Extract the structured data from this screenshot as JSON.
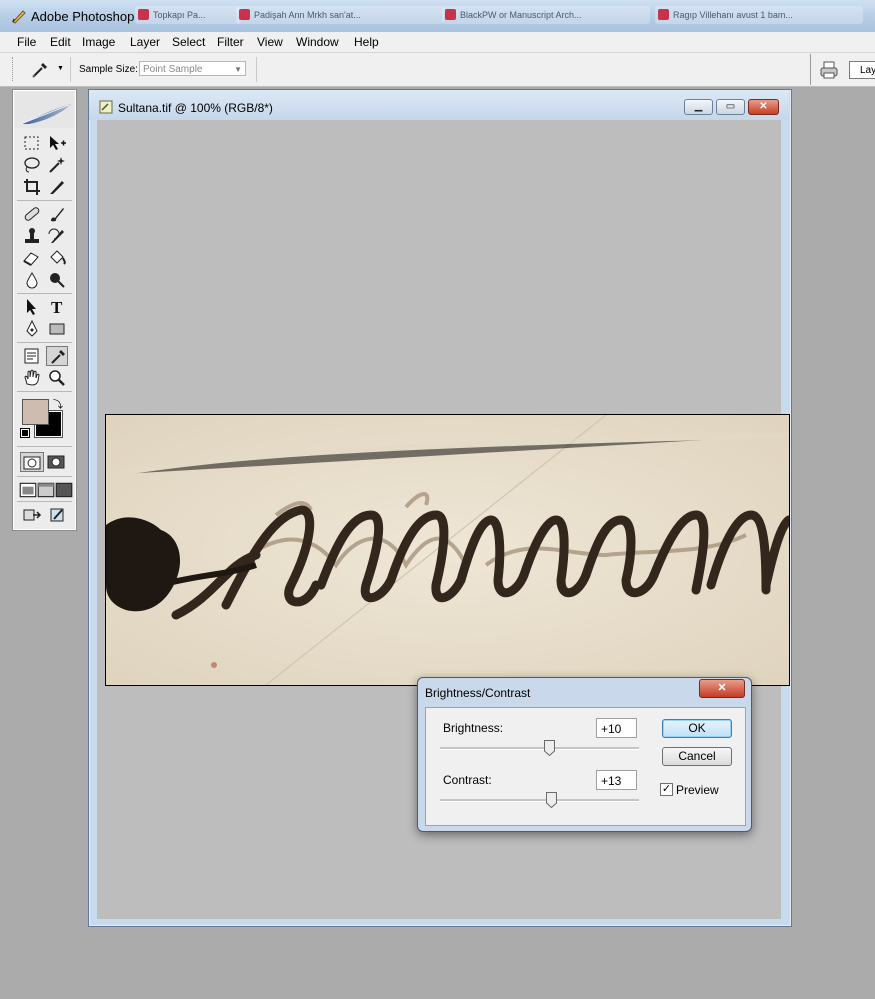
{
  "app": {
    "title": "Adobe Photoshop",
    "taskbar_ghosts": [
      "Topkapı Pa...",
      "Padişah Ann Mrkh san'at...",
      "BlackPW or Manuscript Arch...",
      "Ragıp Villehanı avust 1 bam..."
    ]
  },
  "menu": [
    "File",
    "Edit",
    "Image",
    "Layer",
    "Select",
    "Filter",
    "View",
    "Window",
    "Help"
  ],
  "options": {
    "sample_size_label": "Sample Size:",
    "sample_size_value": "Point Sample",
    "layers_tab": "Lay"
  },
  "toolbox": {
    "foreground_color": "#cdbcaf",
    "background_color": "#000000"
  },
  "document": {
    "title": "Sultana.tif @ 100% (RGB/8*)",
    "minimize_icon": "minimize-icon",
    "maximize_icon": "maximize-icon",
    "close_icon": "close-icon"
  },
  "dialog": {
    "title": "Brightness/Contrast",
    "brightness_label": "Brightness:",
    "brightness_value": "+10",
    "brightness_level": 0.55,
    "contrast_label": "Contrast:",
    "contrast_value": "+13",
    "contrast_level": 0.56,
    "ok_label": "OK",
    "cancel_label": "Cancel",
    "preview_label": "Preview",
    "preview_checked": true
  },
  "colors": {
    "title_bar": "#b7cde6",
    "canvas_bg": "#bdbdbd",
    "paper": "#ece3d3",
    "ink": "#3a2c22"
  }
}
